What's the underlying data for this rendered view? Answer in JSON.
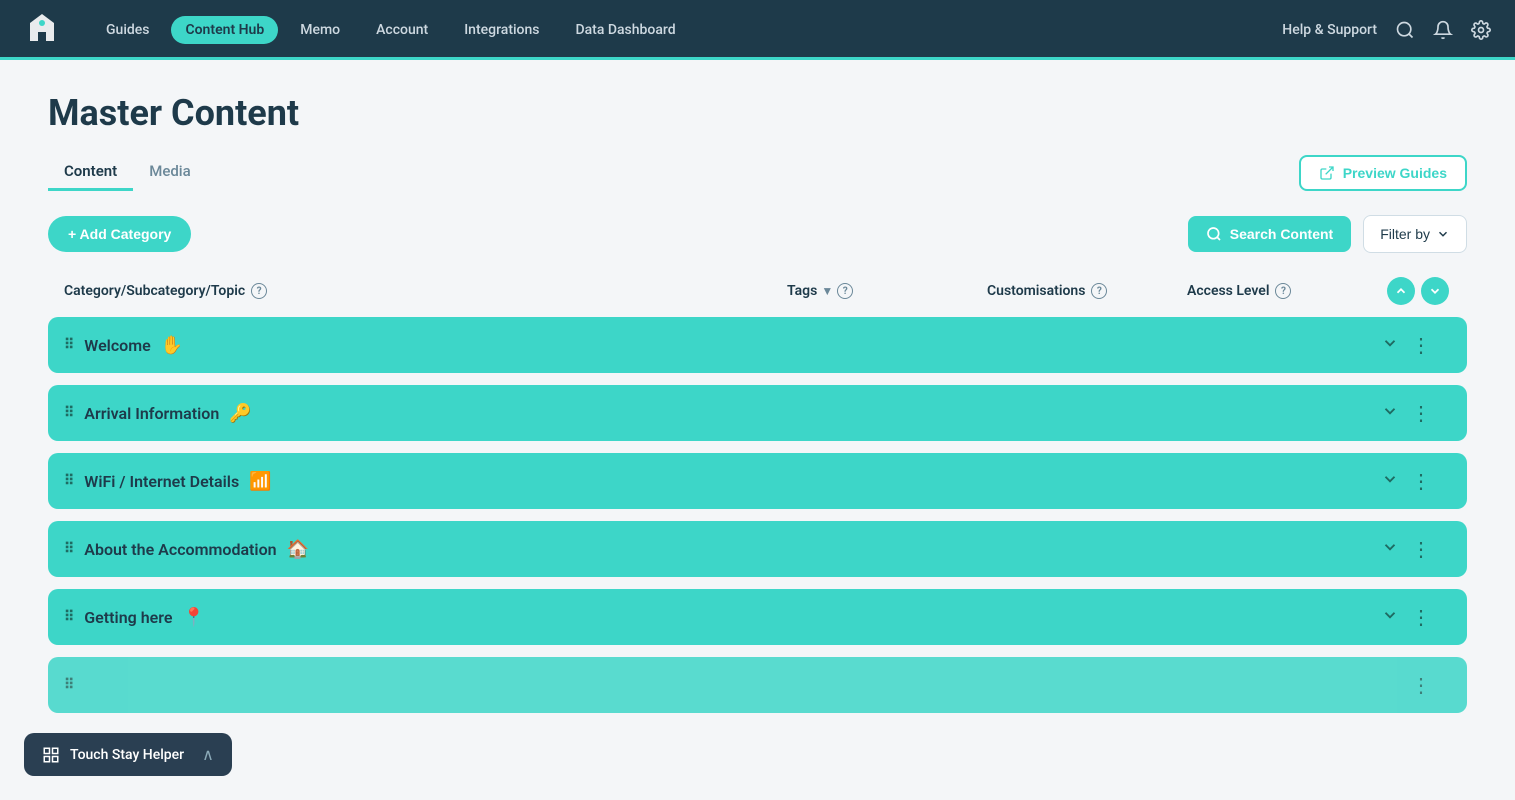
{
  "navbar": {
    "links": [
      {
        "id": "guides",
        "label": "Guides",
        "active": false
      },
      {
        "id": "content-hub",
        "label": "Content Hub",
        "active": true
      },
      {
        "id": "memo",
        "label": "Memo",
        "active": false
      },
      {
        "id": "account",
        "label": "Account",
        "active": false
      },
      {
        "id": "integrations",
        "label": "Integrations",
        "active": false
      },
      {
        "id": "data-dashboard",
        "label": "Data Dashboard",
        "active": false
      }
    ],
    "help_label": "Help & Support"
  },
  "page": {
    "title": "Master Content"
  },
  "tabs": [
    {
      "id": "content",
      "label": "Content",
      "active": true
    },
    {
      "id": "media",
      "label": "Media",
      "active": false
    }
  ],
  "preview_btn": "Preview Guides",
  "add_category_btn": "+ Add Category",
  "search_btn": "Search Content",
  "filter_btn": "Filter by",
  "columns": {
    "category": "Category/Subcategory/Topic",
    "tags": "Tags",
    "customisations": "Customisations",
    "access_level": "Access Level"
  },
  "categories": [
    {
      "id": "welcome",
      "label": "Welcome",
      "icon": "✋"
    },
    {
      "id": "arrival-information",
      "label": "Arrival Information",
      "icon": "🔑"
    },
    {
      "id": "wifi",
      "label": "WiFi / Internet Details",
      "icon": "📶"
    },
    {
      "id": "accommodation",
      "label": "About the Accommodation",
      "icon": "🏠"
    },
    {
      "id": "getting-here",
      "label": "Getting here",
      "icon": "📍"
    },
    {
      "id": "partial",
      "label": "",
      "icon": ""
    }
  ],
  "helper": {
    "label": "Touch Stay Helper",
    "close": "∧"
  }
}
